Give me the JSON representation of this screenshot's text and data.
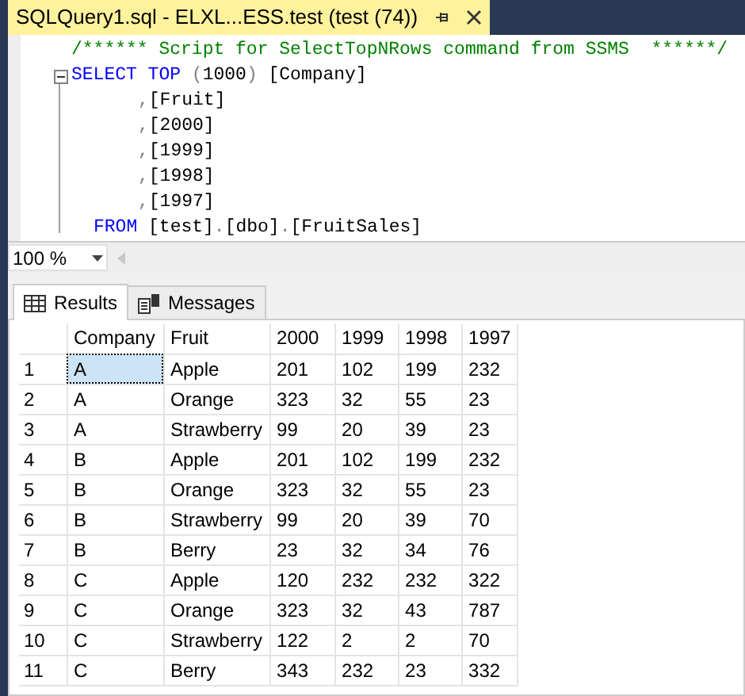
{
  "document_tab": {
    "title": "SQLQuery1.sql - ELXL...ESS.test (test (74))",
    "selected": true
  },
  "editor": {
    "lines": [
      {
        "kind": "comment",
        "collapsible": false,
        "tokens": [
          {
            "kind": "comment",
            "text": "/****** Script for SelectTopNRows command from SSMS  ******/"
          }
        ]
      },
      {
        "kind": "statement",
        "collapsible": true,
        "tokens": [
          {
            "kind": "keyword",
            "text": "SELECT TOP"
          },
          {
            "kind": "punct",
            "text": " ("
          },
          {
            "kind": "plain",
            "text": "1000"
          },
          {
            "kind": "punct",
            "text": ")"
          },
          {
            "kind": "plain",
            "text": " [Company]"
          }
        ]
      },
      {
        "kind": "column",
        "collapsible": false,
        "tokens": [
          {
            "kind": "punct",
            "text": ","
          },
          {
            "kind": "plain",
            "text": "[Fruit]"
          }
        ]
      },
      {
        "kind": "column",
        "collapsible": false,
        "tokens": [
          {
            "kind": "punct",
            "text": ","
          },
          {
            "kind": "plain",
            "text": "[2000]"
          }
        ]
      },
      {
        "kind": "column",
        "collapsible": false,
        "tokens": [
          {
            "kind": "punct",
            "text": ","
          },
          {
            "kind": "plain",
            "text": "[1999]"
          }
        ]
      },
      {
        "kind": "column",
        "collapsible": false,
        "tokens": [
          {
            "kind": "punct",
            "text": ","
          },
          {
            "kind": "plain",
            "text": "[1998]"
          }
        ]
      },
      {
        "kind": "column",
        "collapsible": false,
        "tokens": [
          {
            "kind": "punct",
            "text": ","
          },
          {
            "kind": "plain",
            "text": "[1997]"
          }
        ]
      },
      {
        "kind": "clause",
        "collapsible": false,
        "tokens": [
          {
            "kind": "keyword",
            "text": "FROM"
          },
          {
            "kind": "plain",
            "text": " [test]"
          },
          {
            "kind": "punct",
            "text": "."
          },
          {
            "kind": "plain",
            "text": "[dbo]"
          },
          {
            "kind": "punct",
            "text": "."
          },
          {
            "kind": "plain",
            "text": "[FruitSales]"
          }
        ]
      }
    ]
  },
  "zoom": {
    "value": "100 %"
  },
  "result_tabs": [
    {
      "label": "Results",
      "kind": "grid",
      "selected": true
    },
    {
      "label": "Messages",
      "kind": "messages",
      "selected": false
    }
  ],
  "grid": {
    "columns": [
      "Company",
      "Fruit",
      "2000",
      "1999",
      "1998",
      "1997"
    ],
    "rows": [
      {
        "number": "1",
        "cells": [
          {
            "text": "A",
            "selected": true
          },
          {
            "text": "Apple",
            "selected": false
          },
          {
            "text": "201",
            "selected": false
          },
          {
            "text": "102",
            "selected": false
          },
          {
            "text": "199",
            "selected": false
          },
          {
            "text": "232",
            "selected": false
          }
        ]
      },
      {
        "number": "2",
        "cells": [
          {
            "text": "A",
            "selected": false
          },
          {
            "text": "Orange",
            "selected": false
          },
          {
            "text": "323",
            "selected": false
          },
          {
            "text": "32",
            "selected": false
          },
          {
            "text": "55",
            "selected": false
          },
          {
            "text": "23",
            "selected": false
          }
        ]
      },
      {
        "number": "3",
        "cells": [
          {
            "text": "A",
            "selected": false
          },
          {
            "text": "Strawberry",
            "selected": false
          },
          {
            "text": "99",
            "selected": false
          },
          {
            "text": "20",
            "selected": false
          },
          {
            "text": "39",
            "selected": false
          },
          {
            "text": "23",
            "selected": false
          }
        ]
      },
      {
        "number": "4",
        "cells": [
          {
            "text": "B",
            "selected": false
          },
          {
            "text": "Apple",
            "selected": false
          },
          {
            "text": "201",
            "selected": false
          },
          {
            "text": "102",
            "selected": false
          },
          {
            "text": "199",
            "selected": false
          },
          {
            "text": "232",
            "selected": false
          }
        ]
      },
      {
        "number": "5",
        "cells": [
          {
            "text": "B",
            "selected": false
          },
          {
            "text": "Orange",
            "selected": false
          },
          {
            "text": "323",
            "selected": false
          },
          {
            "text": "32",
            "selected": false
          },
          {
            "text": "55",
            "selected": false
          },
          {
            "text": "23",
            "selected": false
          }
        ]
      },
      {
        "number": "6",
        "cells": [
          {
            "text": "B",
            "selected": false
          },
          {
            "text": "Strawberry",
            "selected": false
          },
          {
            "text": "99",
            "selected": false
          },
          {
            "text": "20",
            "selected": false
          },
          {
            "text": "39",
            "selected": false
          },
          {
            "text": "70",
            "selected": false
          }
        ]
      },
      {
        "number": "7",
        "cells": [
          {
            "text": "B",
            "selected": false
          },
          {
            "text": "Berry",
            "selected": false
          },
          {
            "text": "23",
            "selected": false
          },
          {
            "text": "32",
            "selected": false
          },
          {
            "text": "34",
            "selected": false
          },
          {
            "text": "76",
            "selected": false
          }
        ]
      },
      {
        "number": "8",
        "cells": [
          {
            "text": "C",
            "selected": false
          },
          {
            "text": "Apple",
            "selected": false
          },
          {
            "text": "120",
            "selected": false
          },
          {
            "text": "232",
            "selected": false
          },
          {
            "text": "232",
            "selected": false
          },
          {
            "text": "322",
            "selected": false
          }
        ]
      },
      {
        "number": "9",
        "cells": [
          {
            "text": "C",
            "selected": false
          },
          {
            "text": "Orange",
            "selected": false
          },
          {
            "text": "323",
            "selected": false
          },
          {
            "text": "32",
            "selected": false
          },
          {
            "text": "43",
            "selected": false
          },
          {
            "text": "787",
            "selected": false
          }
        ]
      },
      {
        "number": "10",
        "cells": [
          {
            "text": "C",
            "selected": false
          },
          {
            "text": "Strawberry",
            "selected": false
          },
          {
            "text": "122",
            "selected": false
          },
          {
            "text": "2",
            "selected": false
          },
          {
            "text": "2",
            "selected": false
          },
          {
            "text": "70",
            "selected": false
          }
        ]
      },
      {
        "number": "11",
        "cells": [
          {
            "text": "C",
            "selected": false
          },
          {
            "text": "Berry",
            "selected": false
          },
          {
            "text": "343",
            "selected": false
          },
          {
            "text": "232",
            "selected": false
          },
          {
            "text": "23",
            "selected": false
          },
          {
            "text": "332",
            "selected": false
          }
        ]
      }
    ]
  }
}
